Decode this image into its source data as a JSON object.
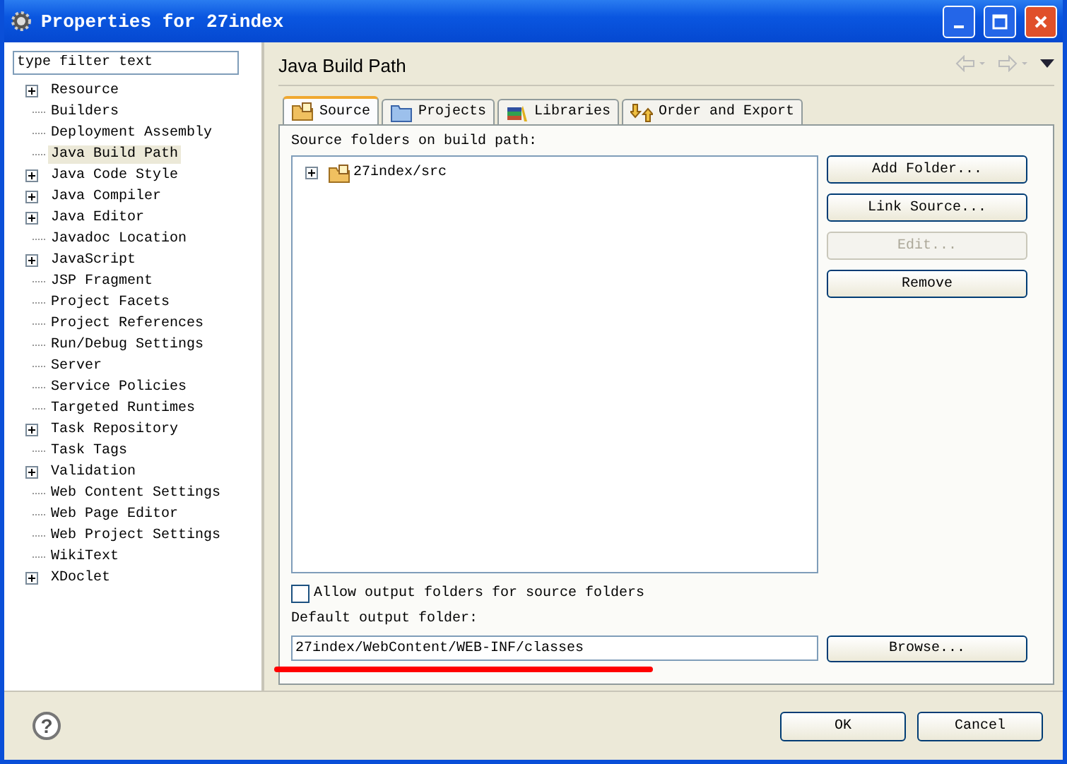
{
  "window": {
    "title": "Properties for 27index"
  },
  "filter": {
    "value": "type filter text"
  },
  "nav_tree": [
    {
      "label": "Resource",
      "expandable": true,
      "selected": false
    },
    {
      "label": "Builders",
      "expandable": false,
      "selected": false
    },
    {
      "label": "Deployment Assembly",
      "expandable": false,
      "selected": false
    },
    {
      "label": "Java Build Path",
      "expandable": false,
      "selected": true
    },
    {
      "label": "Java Code Style",
      "expandable": true,
      "selected": false
    },
    {
      "label": "Java Compiler",
      "expandable": true,
      "selected": false
    },
    {
      "label": "Java Editor",
      "expandable": true,
      "selected": false
    },
    {
      "label": "Javadoc Location",
      "expandable": false,
      "selected": false
    },
    {
      "label": "JavaScript",
      "expandable": true,
      "selected": false
    },
    {
      "label": "JSP Fragment",
      "expandable": false,
      "selected": false
    },
    {
      "label": "Project Facets",
      "expandable": false,
      "selected": false
    },
    {
      "label": "Project References",
      "expandable": false,
      "selected": false
    },
    {
      "label": "Run/Debug Settings",
      "expandable": false,
      "selected": false
    },
    {
      "label": "Server",
      "expandable": false,
      "selected": false
    },
    {
      "label": "Service Policies",
      "expandable": false,
      "selected": false
    },
    {
      "label": "Targeted Runtimes",
      "expandable": false,
      "selected": false
    },
    {
      "label": "Task Repository",
      "expandable": true,
      "selected": false
    },
    {
      "label": "Task Tags",
      "expandable": false,
      "selected": false
    },
    {
      "label": "Validation",
      "expandable": true,
      "selected": false
    },
    {
      "label": "Web Content Settings",
      "expandable": false,
      "selected": false
    },
    {
      "label": "Web Page Editor",
      "expandable": false,
      "selected": false
    },
    {
      "label": "Web Project Settings",
      "expandable": false,
      "selected": false
    },
    {
      "label": "WikiText",
      "expandable": false,
      "selected": false
    },
    {
      "label": "XDoclet",
      "expandable": true,
      "selected": false
    }
  ],
  "page": {
    "title": "Java Build Path"
  },
  "tabs": [
    {
      "label": "Source",
      "selected": true
    },
    {
      "label": "Projects",
      "selected": false
    },
    {
      "label": "Libraries",
      "selected": false
    },
    {
      "label": "Order and Export",
      "selected": false
    }
  ],
  "source_label": "Source folders on build path:",
  "source_folders": [
    {
      "label": "27index/src",
      "expandable": true
    }
  ],
  "side_buttons": [
    {
      "label": "Add Folder...",
      "disabled": false
    },
    {
      "label": "Link Source...",
      "disabled": false
    },
    {
      "label": "Edit...",
      "disabled": true
    },
    {
      "label": "Remove",
      "disabled": false
    }
  ],
  "allow_output": {
    "label": "Allow output folders for source folders",
    "checked": false
  },
  "output_label": "Default output folder:",
  "output_folder": {
    "value": "27index/WebContent/WEB-INF/classes"
  },
  "browse_button": "Browse...",
  "help_button": "?",
  "dialog_buttons": [
    "OK",
    "Cancel"
  ]
}
